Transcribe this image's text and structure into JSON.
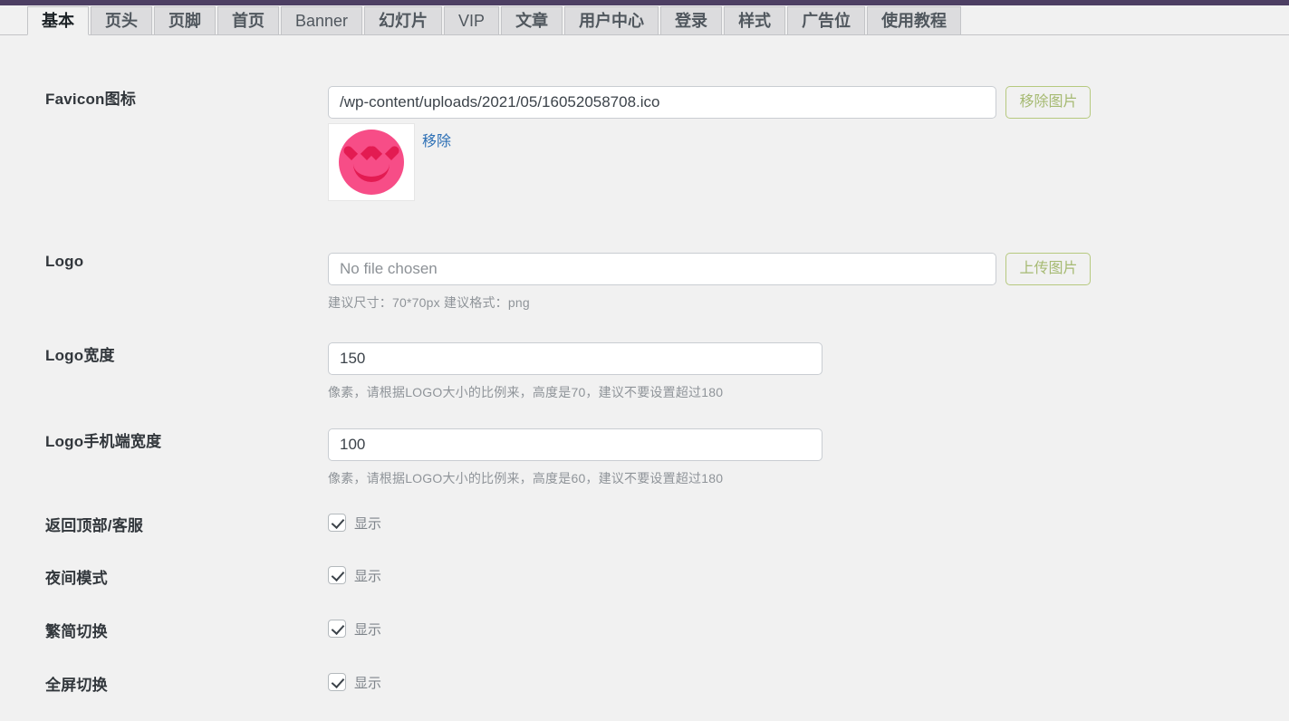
{
  "admin_bar": {
    "color": "#4d3f63"
  },
  "tabs": [
    {
      "label": "基本",
      "active": true,
      "latin": false
    },
    {
      "label": "页头",
      "active": false,
      "latin": false
    },
    {
      "label": "页脚",
      "active": false,
      "latin": false
    },
    {
      "label": "首页",
      "active": false,
      "latin": false
    },
    {
      "label": "Banner",
      "active": false,
      "latin": true
    },
    {
      "label": "幻灯片",
      "active": false,
      "latin": false
    },
    {
      "label": "VIP",
      "active": false,
      "latin": true
    },
    {
      "label": "文章",
      "active": false,
      "latin": false
    },
    {
      "label": "用户中心",
      "active": false,
      "latin": false
    },
    {
      "label": "登录",
      "active": false,
      "latin": false
    },
    {
      "label": "样式",
      "active": false,
      "latin": false
    },
    {
      "label": "广告位",
      "active": false,
      "latin": false
    },
    {
      "label": "使用教程",
      "active": false,
      "latin": false
    }
  ],
  "fields": {
    "favicon": {
      "label": "Favicon图标",
      "value": "/wp-content/uploads/2021/05/16052058708.ico",
      "placeholder": "",
      "button": "移除图片",
      "remove_link": "移除",
      "preview_icon": "pink-smiley-heart-eyes-icon"
    },
    "logo": {
      "label": "Logo",
      "value": "",
      "placeholder": "No file chosen",
      "button": "上传图片",
      "help": "建议尺寸：70*70px 建议格式：png"
    },
    "logo_width": {
      "label": "Logo宽度",
      "value": "150",
      "help": "像素，请根据LOGO大小的比例来，高度是70，建议不要设置超过180"
    },
    "logo_mobile_width": {
      "label": "Logo手机端宽度",
      "value": "100",
      "help": "像素，请根据LOGO大小的比例来，高度是60，建议不要设置超过180"
    }
  },
  "toggles": [
    {
      "label": "返回顶部/客服",
      "checkbox_label": "显示",
      "checked": true
    },
    {
      "label": "夜间模式",
      "checkbox_label": "显示",
      "checked": true
    },
    {
      "label": "繁简切换",
      "checkbox_label": "显示",
      "checked": true
    },
    {
      "label": "全屏切换",
      "checkbox_label": "显示",
      "checked": true
    }
  ],
  "colors": {
    "admin_purple": "#4d3f63",
    "page_bg": "#f1f1f1",
    "button_green": "#a6ba72",
    "link_blue": "#2c6fb5",
    "favicon_pink": "#f74d87"
  }
}
